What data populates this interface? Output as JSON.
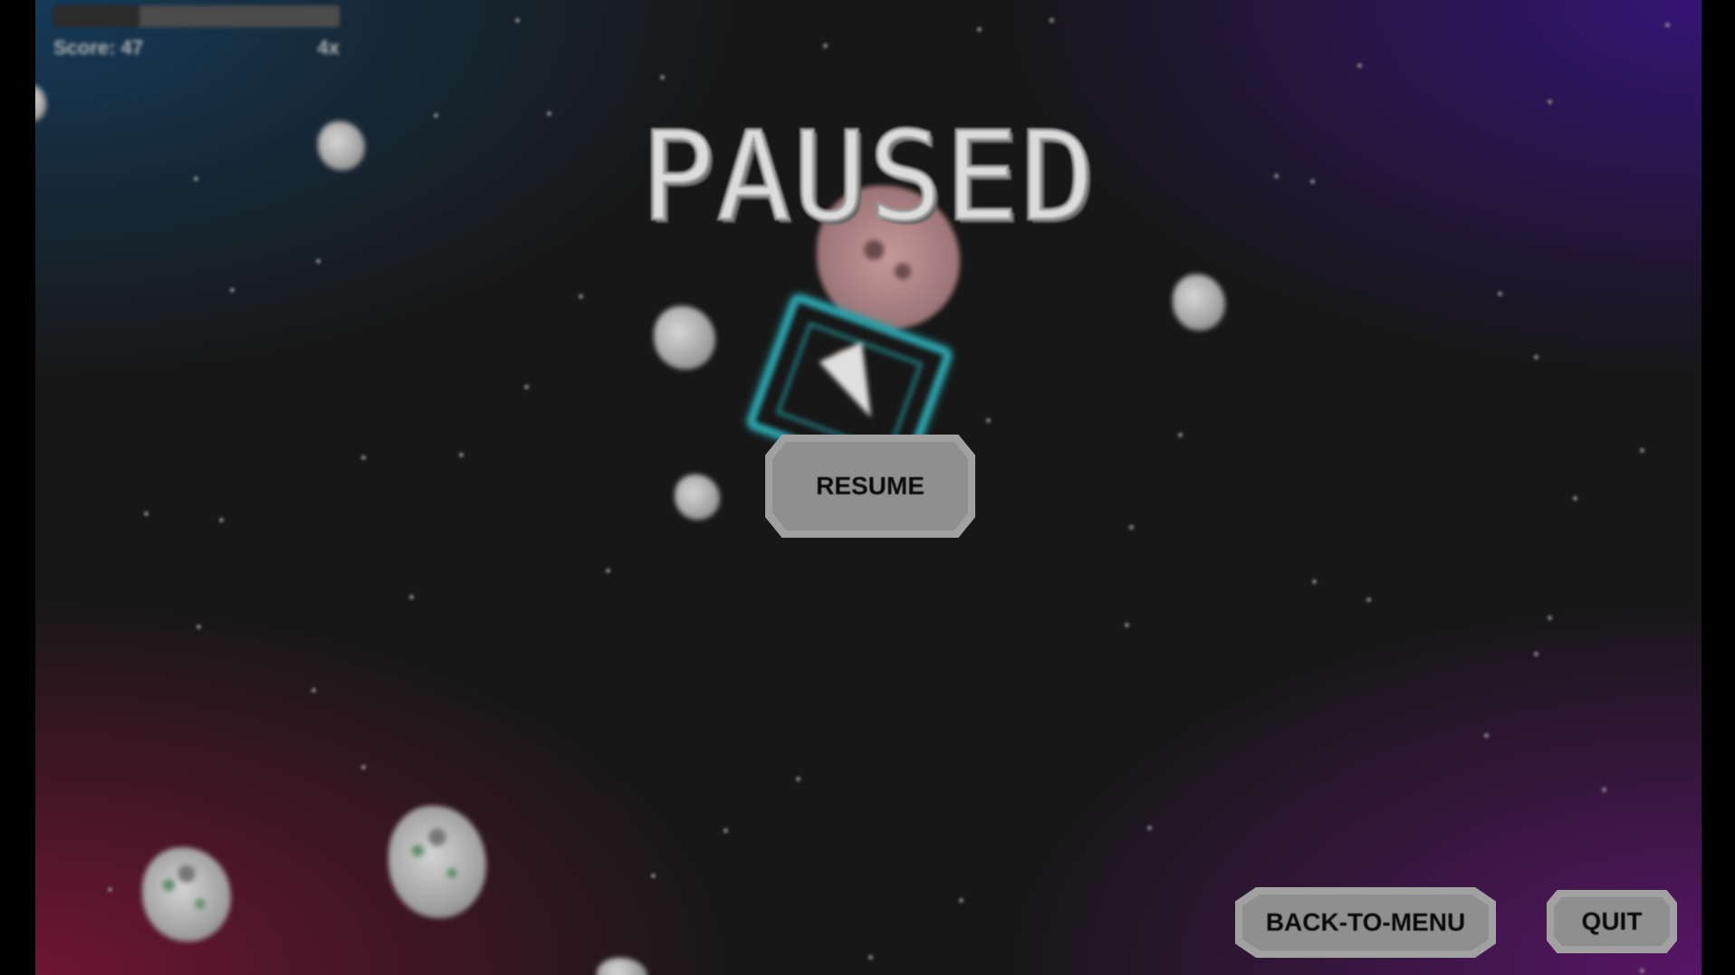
{
  "hud": {
    "health_fraction": 0.3,
    "score_label": "Score: 47",
    "multiplier_label": "4x"
  },
  "overlay": {
    "title": "PAUSED",
    "resume_label": "RESUME",
    "back_to_menu_label": "BACK-TO-MENU",
    "quit_label": "QUIT"
  },
  "colors": {
    "ship_frame": "#2aa0a8",
    "button_fill": "#8f8f8f",
    "title": "#dcdcdc"
  }
}
